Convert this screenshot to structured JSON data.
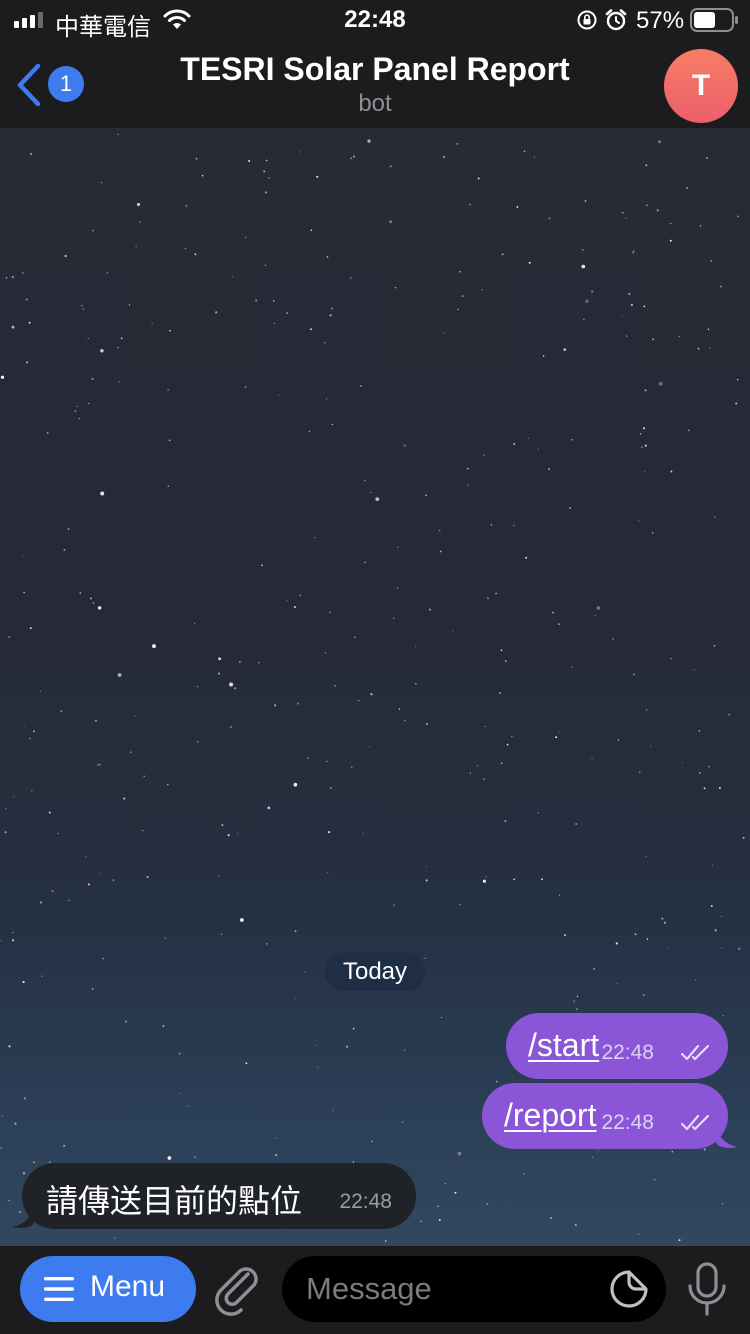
{
  "status_bar": {
    "carrier": "中華電信",
    "time": "22:48",
    "battery_percent": "57%",
    "battery_level": 0.57,
    "icons": [
      "signal-icon",
      "wifi-icon",
      "rotation-lock-icon",
      "alarm-icon",
      "battery-icon"
    ]
  },
  "header": {
    "back_badge": "1",
    "title": "TESRI Solar Panel Report",
    "subtitle": "bot",
    "avatar_letter": "T",
    "colors": {
      "avatar_top": "#f77d63",
      "avatar_bottom": "#ec5f6d",
      "accent": "#3d7bef"
    }
  },
  "messages": {
    "date_separator": "Today",
    "items": [
      {
        "direction": "outgoing",
        "text": "/start",
        "time": "22:48",
        "status": "read"
      },
      {
        "direction": "outgoing",
        "text": "/report",
        "time": "22:48",
        "status": "read"
      },
      {
        "direction": "incoming",
        "text": "請傳送目前的點位",
        "time": "22:48"
      }
    ],
    "colors": {
      "outgoing_bubble": "#8a55d6",
      "incoming_bubble": "#1f2226"
    }
  },
  "input_bar": {
    "menu_label": "Menu",
    "placeholder": "Message",
    "icons": [
      "menu-icon",
      "attach-icon",
      "sticker-icon",
      "microphone-icon"
    ]
  }
}
